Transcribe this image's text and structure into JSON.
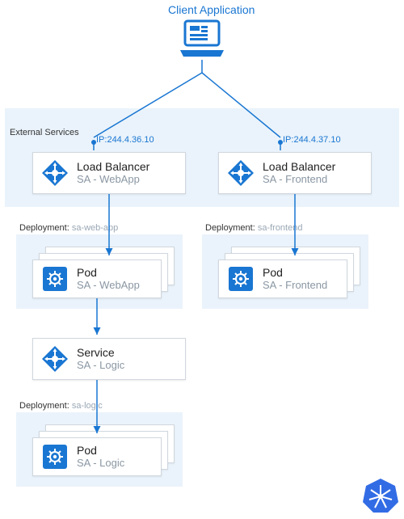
{
  "colors": {
    "accent": "#1976d2",
    "panel": "#eaf3fb",
    "muted": "#8a97a3"
  },
  "title": "Client Application",
  "externalServices": {
    "label": "External Services",
    "left": {
      "ip": "IP:244.4.36.10",
      "title": "Load Balancer",
      "subtitle": "SA - WebApp",
      "icon": "load-balancer-icon"
    },
    "right": {
      "ip": "IP:244.4.37.10",
      "title": "Load Balancer",
      "subtitle": "SA - Frontend",
      "icon": "load-balancer-icon"
    }
  },
  "deployments": {
    "webapp": {
      "labelKey": "Deployment: ",
      "labelVal": "sa-web-app",
      "pod": {
        "title": "Pod",
        "subtitle": "SA - WebApp",
        "icon": "gear-icon"
      }
    },
    "frontend": {
      "labelKey": "Deployment: ",
      "labelVal": "sa-frontend",
      "pod": {
        "title": "Pod",
        "subtitle": "SA - Frontend",
        "icon": "gear-icon"
      }
    },
    "logic": {
      "labelKey": "Deployment: ",
      "labelVal": "sa-logic",
      "pod": {
        "title": "Pod",
        "subtitle": "SA - Logic",
        "icon": "gear-icon"
      }
    }
  },
  "service": {
    "title": "Service",
    "subtitle": "SA - Logic",
    "icon": "load-balancer-icon"
  },
  "badge": {
    "name": "kubernetes-icon"
  }
}
